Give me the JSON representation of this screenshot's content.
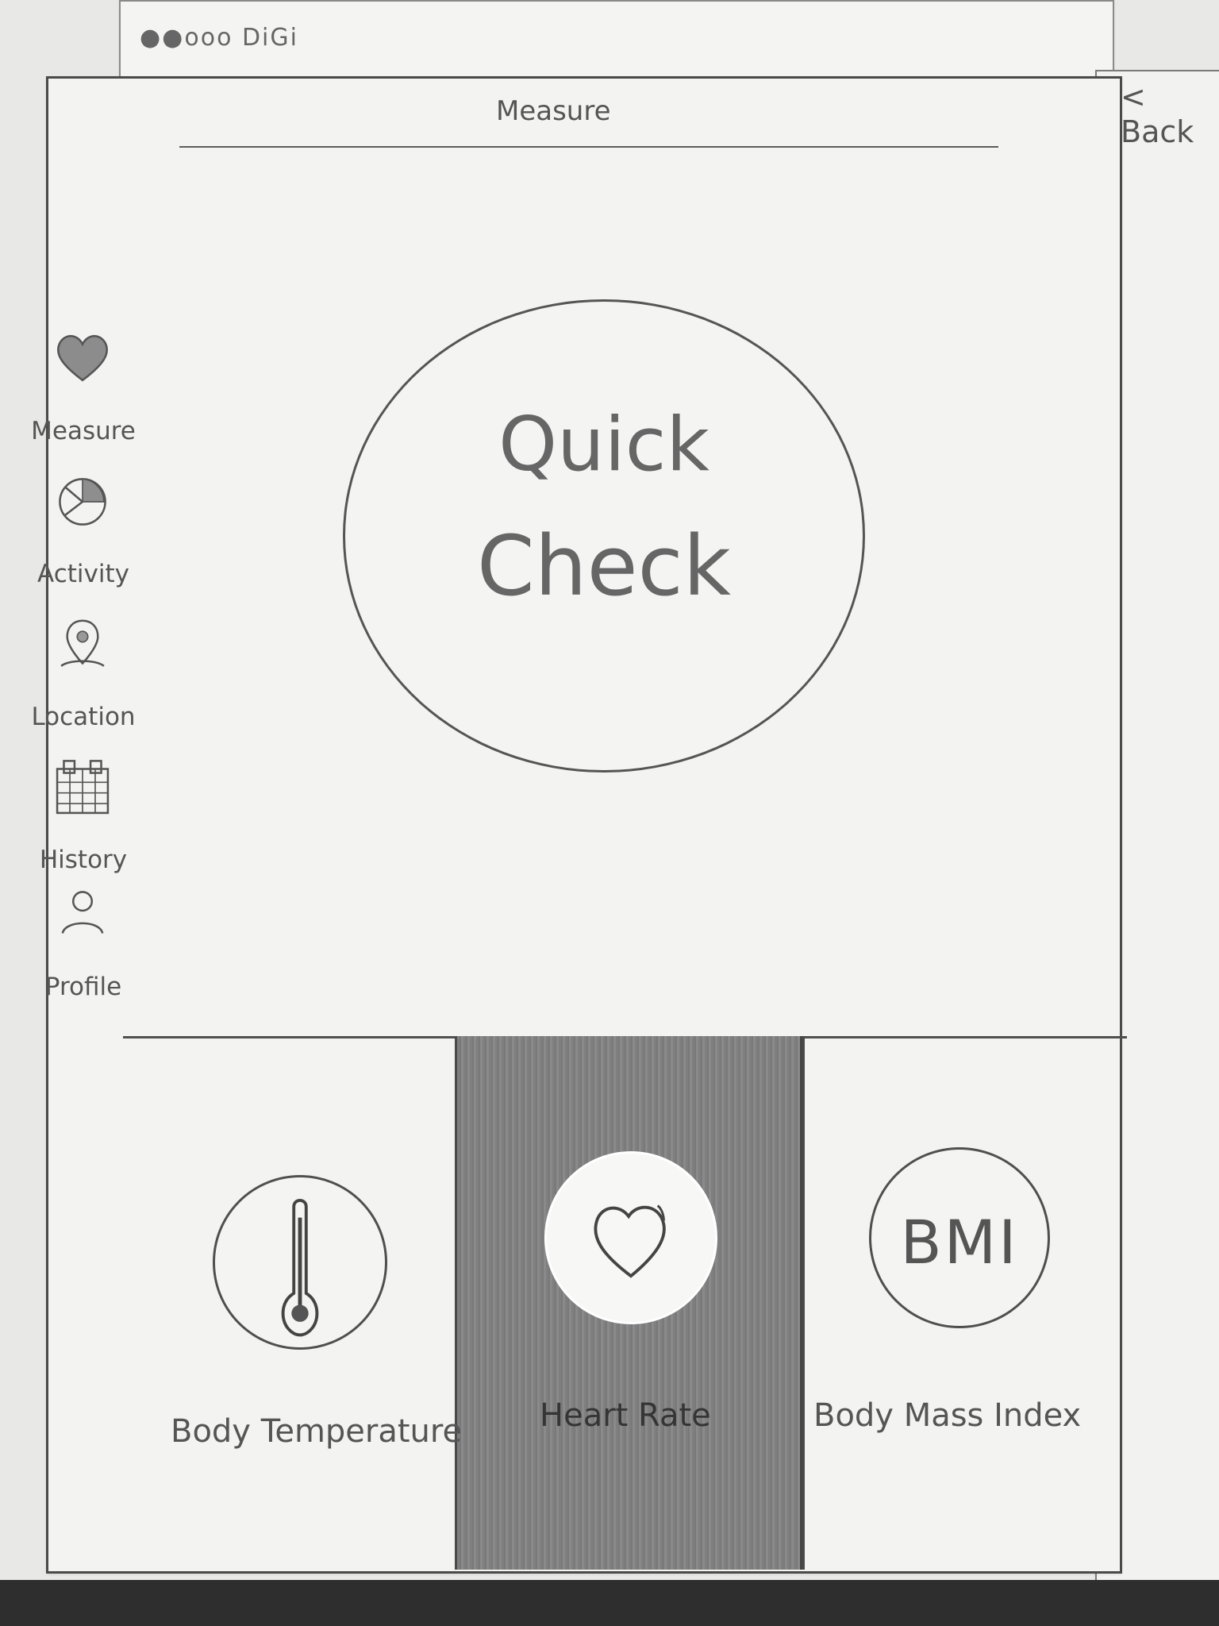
{
  "status_bar": {
    "carrier": "●●ooo DiGi"
  },
  "navigation": {
    "back_label": "< Back",
    "title": "Measure"
  },
  "sidebar": {
    "items": [
      {
        "label": "Measure",
        "icon": "heart-icon"
      },
      {
        "label": "Activity",
        "icon": "pie-chart-icon"
      },
      {
        "label": "Location",
        "icon": "location-pin-icon"
      },
      {
        "label": "History",
        "icon": "calendar-icon"
      },
      {
        "label": "Profile",
        "icon": "person-icon"
      }
    ]
  },
  "main": {
    "quick_check": {
      "line1": "Quick",
      "line2": "Check"
    }
  },
  "metrics": {
    "items": [
      {
        "label": "Body Temperature",
        "icon": "thermometer-icon"
      },
      {
        "label": "Heart Rate",
        "icon": "heart-outline-icon"
      },
      {
        "label": "Body Mass Index",
        "icon_text": "BMI"
      }
    ]
  }
}
